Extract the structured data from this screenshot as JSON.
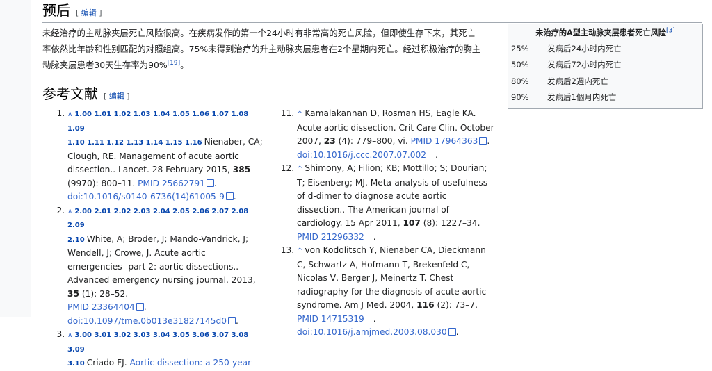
{
  "prognosis": {
    "heading": "预后",
    "edit_label": "编辑",
    "paragraph": "未经治疗的主动脉夹层死亡风险很高。在疾病发作的第一个24小时有非常高的死亡风险，但即使生存下来，其死亡率依然比年龄和性别匹配的对照组高。75%未得到治疗的升主动脉夹层患者在2个星期内死亡。经过积极治疗的胸主动脉夹层患者30天生存率为90%",
    "sup": "[19]",
    "end_mark": "。"
  },
  "infobox": {
    "caption": "未治疗的A型主动脉夹层患者死亡风险",
    "caption_sup": "[3]",
    "rows": [
      {
        "pct": "25%",
        "label": "发病后24小时内死亡"
      },
      {
        "pct": "50%",
        "label": "发病后72小时内死亡"
      },
      {
        "pct": "80%",
        "label": "发病后2週内死亡"
      },
      {
        "pct": "90%",
        "label": "发病后1個月内死亡"
      }
    ]
  },
  "references": {
    "heading": "参考文献",
    "edit_label": "编辑",
    "r1": {
      "backlinks_a": "1.00 1.01 1.02 1.03 1.04 1.05 1.06 1.07 1.08 1.09",
      "backlinks_b": "1.10 1.11 1.12 1.13 1.14 1.15 1.16",
      "text": "Nienaber, CA; Clough, RE. Management of acute aortic dissection.. Lancet. 28 February 2015,",
      "vol": "385",
      "pages": "(9970): 800–11.",
      "pmid": "PMID 25662791",
      "doi": "doi:10.1016/s0140-6736(14)61005-9"
    },
    "r2": {
      "backlinks_a": "2.00 2.01 2.02 2.03 2.04 2.05 2.06 2.07 2.08 2.09",
      "backlinks_b": "2.10",
      "text": "White, A; Broder, J; Mando-Vandrick, J; Wendell, J; Crowe, J. Acute aortic emergencies--part 2: aortic dissections.. Advanced emergency nursing journal. 2013,",
      "vol": "35",
      "pages": "(1): 28–52.",
      "pmid": "PMID 23364404",
      "doi": "doi:10.1097/tme.0b013e31827145d0"
    },
    "r3": {
      "backlinks_a": "3.00 3.01 3.02 3.03 3.04 3.05 3.06 3.07 3.08 3.09",
      "backlinks_b": "3.10",
      "text": "Criado FJ.",
      "title_link": "Aortic dissection: a 250-year"
    },
    "r11": {
      "text": "Kamalakannan D, Rosman HS, Eagle KA. Acute aortic dissection. Crit Care Clin. October 2007,",
      "vol": "23",
      "pages": "(4): 779–800, vi.",
      "pmid": "PMID 17964363",
      "doi": "doi:10.1016/j.ccc.2007.07.002"
    },
    "r12": {
      "text": "Shimony, A; Filion; KB; Mottillo; S; Dourian; T; Eisenberg; MJ. Meta-analysis of usefulness of d-dimer to diagnose acute aortic dissection.. The American journal of cardiology. 15 Apr 2011,",
      "vol": "107",
      "pages": "(8): 1227–34.",
      "pmid": "PMID 21296332"
    },
    "r13": {
      "text": "von Kodolitsch Y, Nienaber CA, Dieckmann C, Schwartz A, Hofmann T, Brekenfeld C, Nicolas V, Berger J, Meinertz T. Chest radiography for the diagnosis of acute aortic syndrome. Am J Med. 2004,",
      "vol": "116",
      "pages": "(2): 73–7.",
      "pmid": "PMID 14715319",
      "doi": "doi:10.1016/j.amjmed.2003.08.030"
    }
  }
}
